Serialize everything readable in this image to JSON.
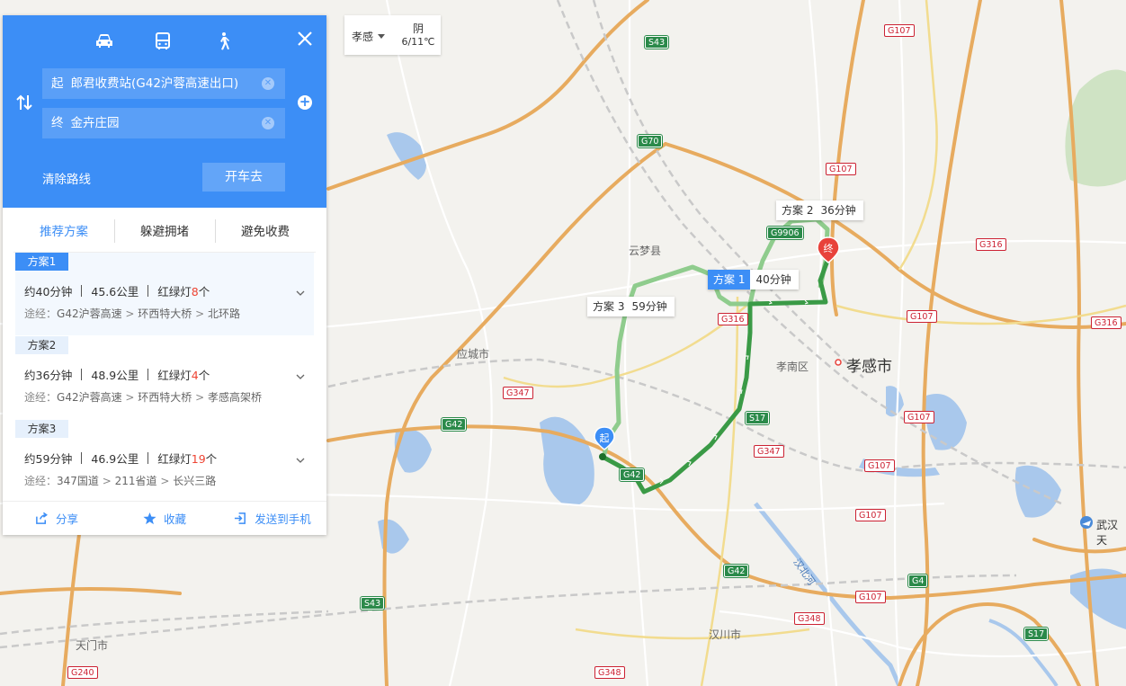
{
  "panel": {
    "modes": [
      "car-icon",
      "bus-icon",
      "walk-icon"
    ],
    "start": {
      "tag": "起",
      "value": "郎君收费站(G42沪蓉高速出口)"
    },
    "end": {
      "tag": "终",
      "value": "金卉庄园"
    },
    "clear_route_label": "清除路线",
    "go_button_label": "开车去",
    "tabs": [
      "推荐方案",
      "躲避拥堵",
      "避免收费"
    ],
    "plans": [
      {
        "name": "方案1",
        "time": "约40分钟",
        "distance": "45.6公里",
        "lights_label": "红绿灯",
        "lights_count": "8",
        "lights_unit": "个",
        "via_label": "途经：",
        "via": [
          "G42沪蓉高速",
          "环西特大桥",
          "北环路"
        ]
      },
      {
        "name": "方案2",
        "time": "约36分钟",
        "distance": "48.9公里",
        "lights_label": "红绿灯",
        "lights_count": "4",
        "lights_unit": "个",
        "via_label": "途经：",
        "via": [
          "G42沪蓉高速",
          "环西特大桥",
          "孝感高架桥"
        ]
      },
      {
        "name": "方案3",
        "time": "约59分钟",
        "distance": "46.9公里",
        "lights_label": "红绿灯",
        "lights_count": "19",
        "lights_unit": "个",
        "via_label": "途经：",
        "via": [
          "347国道",
          "211省道",
          "长兴三路"
        ]
      }
    ],
    "footer": {
      "share": "分享",
      "favorite": "收藏",
      "send_to_phone": "发送到手机"
    }
  },
  "weather": {
    "city": "孝感",
    "condition": "阴",
    "temperature": "6/11℃"
  },
  "route_labels": [
    {
      "name": "方案 1",
      "time": "40分钟"
    },
    {
      "name": "方案 2",
      "time": "36分钟"
    },
    {
      "name": "方案 3",
      "time": "59分钟"
    }
  ],
  "markers": {
    "start": "起",
    "end": "终"
  },
  "places": {
    "xiaogan": "孝感市",
    "xiaonan": "孝南区",
    "yunmeng": "云梦县",
    "yingcheng": "应城市",
    "hanchuan": "汉川市",
    "tianmen": "天门市",
    "wuhan": "武汉天",
    "river": "汉北河"
  },
  "road_shields": {
    "S43_top": "S43",
    "G107_a": "G107",
    "G70": "G70",
    "G107_b": "G107",
    "G9906": "G9906",
    "G316_a": "G316",
    "G316_b": "G316",
    "G107_c": "G107",
    "G316_c": "G316",
    "G107_d": "G107",
    "S17_a": "S17",
    "G347_a": "G347",
    "G347_b": "G347",
    "G42_a": "G42",
    "G42_b": "G42",
    "G107_e": "G107",
    "G107_f": "G107",
    "G4": "G4",
    "G42_c": "G42",
    "G107_g": "G107",
    "S43_b": "S43",
    "G348_a": "G348",
    "G348_b": "G348",
    "G240": "G240",
    "S17_b": "S17"
  },
  "colors": {
    "accent": "#3c8ef6",
    "route_selected": "#3a9a46",
    "route_alt": "#8fcc8d",
    "highway": "#e7ab5f",
    "lights_red": "#e43333"
  }
}
